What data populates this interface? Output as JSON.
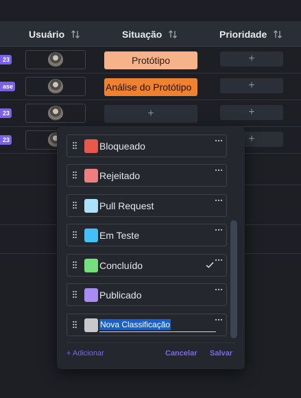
{
  "table": {
    "columns": [
      {
        "label": "Usuário",
        "icon": "sort-icon"
      },
      {
        "label": "Situação",
        "icon": "sort-icon"
      },
      {
        "label": "Prioridade",
        "icon": "sort-icon"
      }
    ],
    "rows": [
      {
        "tag": "23",
        "status": "Protótipo",
        "priority_placeholder": "+"
      },
      {
        "tag": "ase",
        "status": "Análise do Protótipo",
        "priority_placeholder": "+"
      },
      {
        "tag": "23",
        "status": "+",
        "priority_placeholder": "+"
      },
      {
        "tag": "23",
        "status": "",
        "priority_placeholder": "+"
      }
    ]
  },
  "dropdown": {
    "options": [
      {
        "label": "Bloqueado",
        "color": "#e8584b",
        "more_icon": "more-horizontal-icon"
      },
      {
        "label": "Rejeitado",
        "color": "#ef7f7f",
        "more_icon": "more-horizontal-icon"
      },
      {
        "label": "Pull Request",
        "color": "#a8e3fb",
        "more_icon": "more-horizontal-icon"
      },
      {
        "label": "Em Teste",
        "color": "#43c0f6",
        "more_icon": "more-horizontal-icon"
      },
      {
        "label": "Concluído",
        "color": "#75e07b",
        "selected": true,
        "more_icon": "more-horizontal-icon"
      },
      {
        "label": "Publicado",
        "color": "#a98bf4",
        "more_icon": "more-horizontal-icon"
      }
    ],
    "new_option": {
      "value": "Nova Classificação",
      "color": "#c8c8c8"
    },
    "add_label": "+ Adicionar",
    "cancel_label": "Cancelar",
    "save_label": "Salvar"
  },
  "colors": {
    "accent": "#7b61e8",
    "header_bg": "#2a2e36",
    "page_bg": "#1d1f24"
  }
}
